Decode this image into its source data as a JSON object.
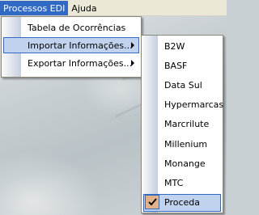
{
  "menubar": {
    "items": [
      {
        "label": "Processos EDI",
        "active": true
      },
      {
        "label": "Ajuda",
        "active": false
      }
    ]
  },
  "main_menu": {
    "items": [
      {
        "label": "Tabela de Ocorrências",
        "has_submenu": false
      },
      {
        "label": "Importar Informações...",
        "has_submenu": true,
        "highlighted": true
      },
      {
        "label": "Exportar Informações...",
        "has_submenu": true
      }
    ]
  },
  "import_submenu": {
    "items": [
      {
        "label": "B2W"
      },
      {
        "label": "BASF"
      },
      {
        "label": "Data Sul"
      },
      {
        "label": "Hypermarcas"
      },
      {
        "label": "Marcrilute"
      },
      {
        "label": "Millenium"
      },
      {
        "label": "Monange"
      },
      {
        "label": "MTC"
      },
      {
        "label": "Proceda",
        "checked": true,
        "icon": "checkmark-icon"
      }
    ]
  },
  "colors": {
    "menubar_bg": "#ebe8d8",
    "highlight_bg": "#c1d2ee",
    "highlight_border": "#316ac5",
    "active_menu_bg": "#316ac5",
    "check_bg": "#e1b28a"
  }
}
